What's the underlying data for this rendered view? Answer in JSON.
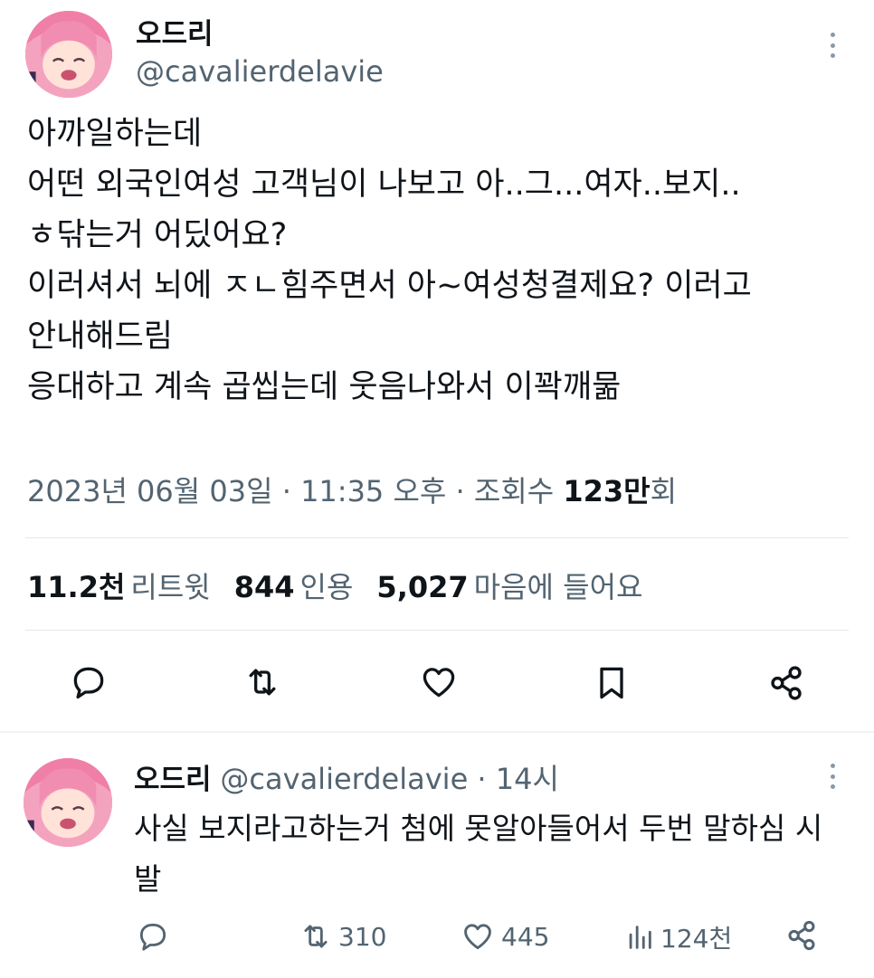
{
  "tweet": {
    "author": {
      "display_name": "오드리",
      "handle": "@cavalierdelavie"
    },
    "text_lines": [
      "아까일하는데",
      "어떤 외국인여성 고객님이 나보고 아..그...여자..보지..",
      "ㅎ닦는거 어딨어요?",
      "이러셔서 뇌에 ㅈㄴ힘주면서 아~여성청결제요? 이러고",
      "안내해드림",
      "응대하고 계속 곱씹는데 웃음나와서 이꽉깨묾"
    ],
    "meta": {
      "date": "2023년 06월 03일",
      "sep1": " · ",
      "time": "11:35 오후",
      "sep2": " · ",
      "views_label": "조회수 ",
      "views_value": "123만",
      "views_suffix": "회"
    },
    "stats": {
      "retweets_value": "11.2천",
      "retweets_label": "리트윗",
      "quotes_value": "844",
      "quotes_label": "인용",
      "likes_value": "5,027",
      "likes_label": "마음에 들어요"
    },
    "actions": [
      "reply-icon",
      "retweet-icon",
      "like-icon",
      "bookmark-icon",
      "share-icon"
    ]
  },
  "reply": {
    "author": {
      "display_name": "오드리",
      "handle": "@cavalierdelavie",
      "time_sep": " · ",
      "time": "14시"
    },
    "text_lines": [
      "사실 보지라고하는거 첨에 못알아들어서 두번 말하심 시",
      "발"
    ],
    "counts": {
      "retweets": "310",
      "likes": "445",
      "views": "124천"
    }
  },
  "colors": {
    "text": "#0f1419",
    "secondary": "#536471",
    "divider": "#e3e7ea",
    "avatar_pink": "#f7a8c2"
  }
}
